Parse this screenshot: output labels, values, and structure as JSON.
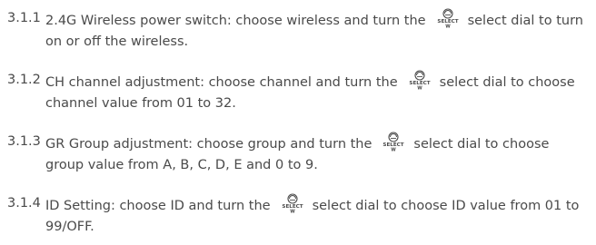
{
  "items": [
    {
      "number": "3.1.1",
      "before": "2.4G Wireless power switch: choose wireless and turn the",
      "after": "select dial to turn on or off the wireless."
    },
    {
      "number": "3.1.2",
      "before": "CH channel adjustment: choose channel and turn the",
      "after": "select dial to choose channel value from 01 to 32."
    },
    {
      "number": "3.1.3",
      "before": "GR Group adjustment: choose group and turn the",
      "after": "select dial to choose group value from A, B, C, D, E and 0 to 9."
    },
    {
      "number": "3.1.4",
      "before": "ID Setting: choose ID and turn the",
      "after": "select dial to choose ID value from 01 to 99/OFF."
    }
  ],
  "dial_icon": {
    "label": "SELECT",
    "sublabel": "W",
    "name": "select-dial-icon"
  }
}
